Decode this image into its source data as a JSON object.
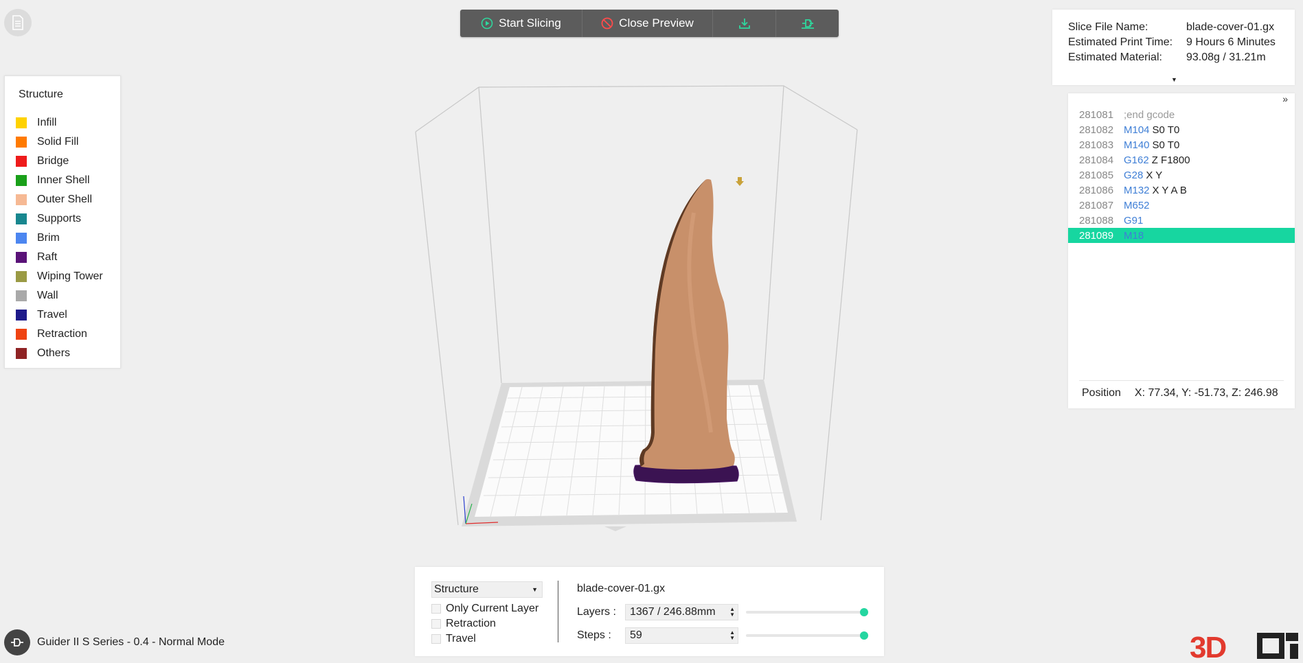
{
  "toolbar": {
    "start_slicing": "Start Slicing",
    "close_preview": "Close Preview"
  },
  "legend": {
    "title": "Structure",
    "items": [
      {
        "label": "Infill",
        "color": "#ffd200"
      },
      {
        "label": "Solid Fill",
        "color": "#ff7a00"
      },
      {
        "label": "Bridge",
        "color": "#ee1b1b"
      },
      {
        "label": "Inner Shell",
        "color": "#1aa01a"
      },
      {
        "label": "Outer Shell",
        "color": "#f6b994"
      },
      {
        "label": "Supports",
        "color": "#18878f"
      },
      {
        "label": "Brim",
        "color": "#4c86f0"
      },
      {
        "label": "Raft",
        "color": "#5a1278"
      },
      {
        "label": "Wiping Tower",
        "color": "#9a9a44"
      },
      {
        "label": "Wall",
        "color": "#a9a9a9"
      },
      {
        "label": "Travel",
        "color": "#1e1a8a"
      },
      {
        "label": "Retraction",
        "color": "#ef4312"
      },
      {
        "label": "Others",
        "color": "#8f2324"
      }
    ]
  },
  "info": {
    "file_name_label": "Slice File Name:",
    "file_name": "blade-cover-01.gx",
    "time_label": "Estimated Print Time:",
    "time": "9 Hours 6 Minutes",
    "material_label": "Estimated Material:",
    "material": "93.08g / 31.21m"
  },
  "gcode": {
    "lines": [
      {
        "num": "281081",
        "cmd": "",
        "args": ";end gcode",
        "comment": true
      },
      {
        "num": "281082",
        "cmd": "M104",
        "args": "S0 T0"
      },
      {
        "num": "281083",
        "cmd": "M140",
        "args": "S0 T0"
      },
      {
        "num": "281084",
        "cmd": "G162",
        "args": "Z F1800"
      },
      {
        "num": "281085",
        "cmd": "G28",
        "args": "X Y"
      },
      {
        "num": "281086",
        "cmd": "M132",
        "args": "X Y A B"
      },
      {
        "num": "281087",
        "cmd": "M652",
        "args": ""
      },
      {
        "num": "281088",
        "cmd": "G91",
        "args": ""
      },
      {
        "num": "281089",
        "cmd": "M18",
        "args": "",
        "active": true
      }
    ],
    "position_label": "Position",
    "position_value": "X: 77.34, Y: -51.73, Z: 246.98"
  },
  "controls": {
    "view_mode": "Structure",
    "only_current_layer": "Only Current Layer",
    "retraction": "Retraction",
    "travel": "Travel",
    "file_name": "blade-cover-01.gx",
    "layers_label": "Layers :",
    "layers_value": "1367 / 246.88mm",
    "steps_label": "Steps :",
    "steps_value": "59",
    "layers_fraction": 1.0,
    "steps_fraction": 1.0
  },
  "status": {
    "printer": "Guider II S Series - 0.4 - Normal Mode"
  },
  "colors": {
    "accent": "#17d6a0",
    "model": "#c8906a"
  }
}
